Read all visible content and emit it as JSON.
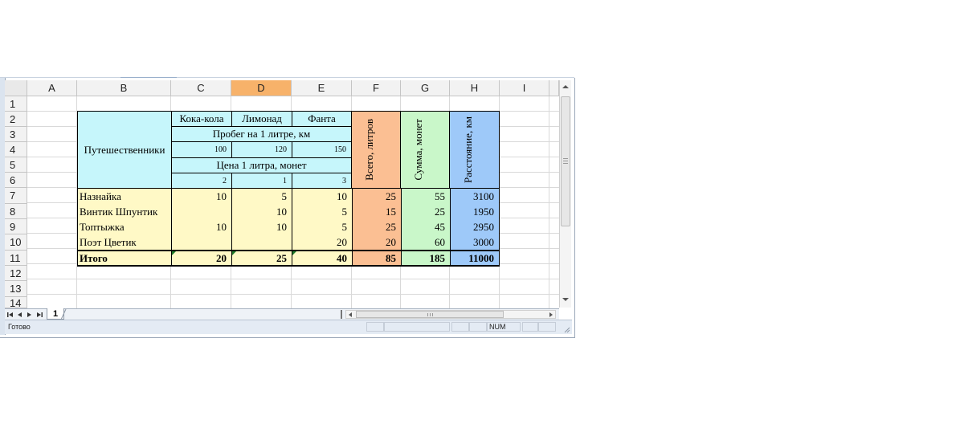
{
  "columns": [
    "A",
    "B",
    "C",
    "D",
    "E",
    "F",
    "G",
    "H",
    "I"
  ],
  "rows": [
    "1",
    "2",
    "3",
    "4",
    "5",
    "6",
    "7",
    "8",
    "9",
    "10",
    "11",
    "12",
    "13",
    "14"
  ],
  "table": {
    "travelers_header": "Путешественники",
    "drinks": [
      "Кока-кола",
      "Лимонад",
      "Фанта"
    ],
    "mileage_label": "Пробег на 1 литре, км",
    "mileage": [
      "100",
      "120",
      "150"
    ],
    "price_label": "Цена 1 литра, монет",
    "price": [
      "2",
      "1",
      "3"
    ],
    "total_liters_header": "Всего, литров",
    "sum_header": "Сумма, монет",
    "distance_header": "Расстояние, км",
    "data_rows": [
      {
        "name": "Назнайка",
        "c": "10",
        "d": "5",
        "e": "10",
        "f": "25",
        "g": "55",
        "h": "3100"
      },
      {
        "name": "Винтик Шпунтик",
        "c": "",
        "d": "10",
        "e": "5",
        "f": "15",
        "g": "25",
        "h": "1950"
      },
      {
        "name": "Топтыжка",
        "c": "10",
        "d": "10",
        "e": "5",
        "f": "25",
        "g": "45",
        "h": "2950"
      },
      {
        "name": "Поэт Цветик",
        "c": "",
        "d": "",
        "e": "20",
        "f": "20",
        "g": "60",
        "h": "3000"
      }
    ],
    "total_row": {
      "name": "Итого",
      "c": "20",
      "d": "25",
      "e": "40",
      "f": "85",
      "g": "185",
      "h": "11000"
    }
  },
  "sheet_tab": "1",
  "status": {
    "ready": "Готово",
    "num": "NUM"
  },
  "icons": {
    "nav": [
      "first-sheet-icon",
      "prev-sheet-icon",
      "next-sheet-icon",
      "last-sheet-icon"
    ]
  },
  "colors": {
    "cyan": "#c6f6fb",
    "yellow": "#fff9c6",
    "orange": "#fbbf93",
    "green": "#c9f7c9",
    "blue": "#9ec9f9",
    "selected_header": "#f7b26a"
  }
}
